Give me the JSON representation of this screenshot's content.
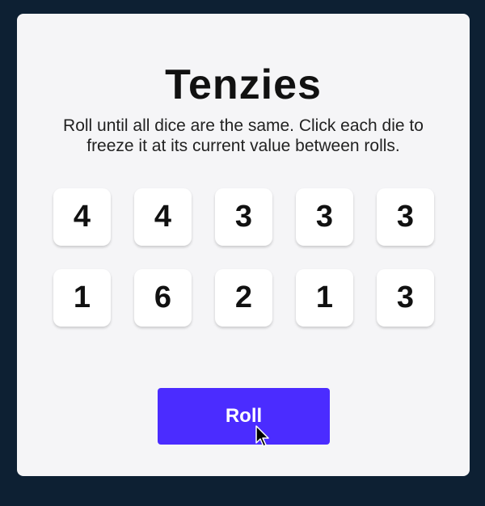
{
  "title": "Tenzies",
  "instructions": "Roll until all dice are the same. Click each die to freeze it at its current value between rolls.",
  "dice": [
    {
      "value": "4"
    },
    {
      "value": "4"
    },
    {
      "value": "3"
    },
    {
      "value": "3"
    },
    {
      "value": "3"
    },
    {
      "value": "1"
    },
    {
      "value": "6"
    },
    {
      "value": "2"
    },
    {
      "value": "1"
    },
    {
      "value": "3"
    }
  ],
  "roll_button": {
    "label": "Roll"
  },
  "icons": {
    "cursor": "mouse-pointer-icon"
  },
  "colors": {
    "background": "#0d2033",
    "card": "#f5f5f7",
    "die": "#ffffff",
    "button": "#4b2cff",
    "button_text": "#ffffff"
  }
}
